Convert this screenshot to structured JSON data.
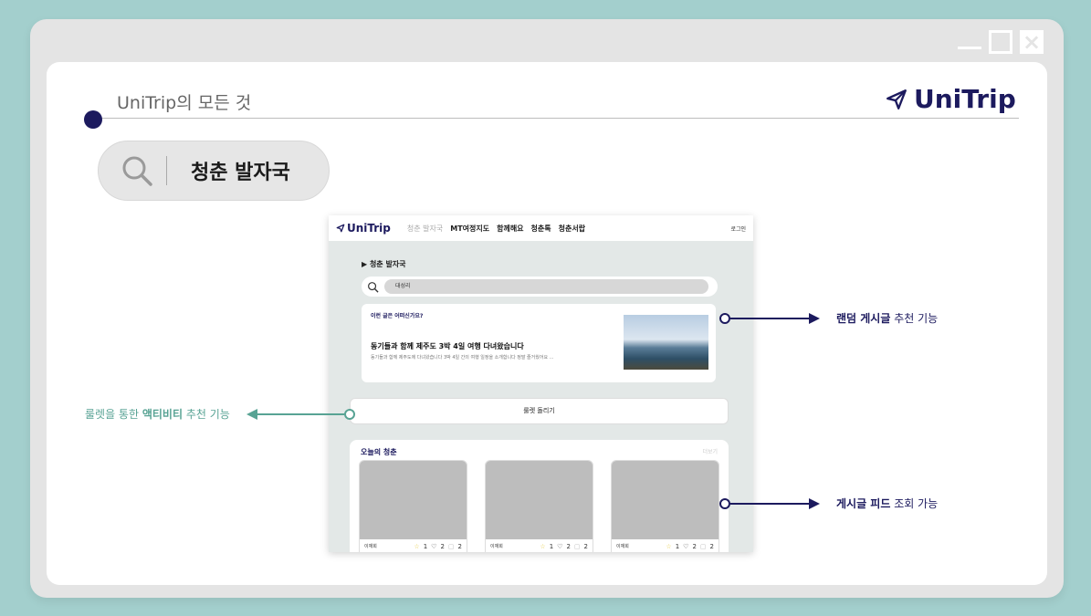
{
  "panel": {
    "tagline": "UniTrip의 모든 것",
    "brand": "UniTrip",
    "search_query": "청춘 발자국"
  },
  "screenshot": {
    "logo": "UniTrip",
    "nav": [
      "청춘 발자국",
      "MT여정지도",
      "함께해요",
      "청춘톡",
      "청춘서랍"
    ],
    "login": "로그인",
    "section_title": "▶ 청춘 발자국",
    "search_value": "대성리",
    "random_card": {
      "question": "이런 글은 어떠신가요?",
      "title": "동기들과 함께 제주도 3박 4일 여행 다녀왔습니다",
      "desc": "동기들과 함께 제주도에 다녀왔습니다 3박 4일 간의 여행 일정을 소개합니다 정말 즐거웠어요 ..."
    },
    "roulette_label": "룰렛 돌리기",
    "feed": {
      "title": "오늘의 청춘",
      "more": "더보기",
      "posts": [
        {
          "author": "이재희",
          "stars": "1",
          "likes": "2",
          "comments": "2"
        },
        {
          "author": "이재희",
          "stars": "1",
          "likes": "2",
          "comments": "2"
        },
        {
          "author": "이재희",
          "stars": "1",
          "likes": "2",
          "comments": "2"
        }
      ]
    }
  },
  "callouts": {
    "random": {
      "bold": "랜덤 게시글",
      "rest": " 추천 기능"
    },
    "roulette": {
      "pre": "룰렛을 통한 ",
      "bold": "액티비티",
      "rest": " 추천 기능"
    },
    "feed": {
      "bold": "게시글 피드",
      "rest": " 조회 가능"
    }
  },
  "colors": {
    "navy": "#1c1a5e",
    "teal": "#58a394",
    "background": "#a3cfcd"
  }
}
